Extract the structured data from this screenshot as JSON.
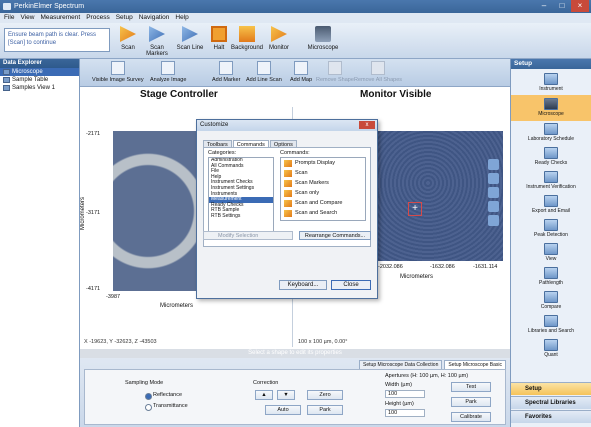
{
  "window": {
    "title": "PerkinElmer Spectrum"
  },
  "menu": [
    "File",
    "View",
    "Measurement",
    "Process",
    "Setup",
    "Navigation",
    "Help"
  ],
  "ribbon": {
    "message": "Ensure beam path is clear. Press [Scan] to continue",
    "buttons": [
      "Scan",
      "Scan Markers",
      "Scan Line",
      "Halt",
      "Background",
      "Monitor",
      "Microscope"
    ]
  },
  "sidebar": {
    "title": "Data Explorer",
    "items": [
      "Microscope",
      "Sample Table",
      "Samples View 1"
    ]
  },
  "toolbar": {
    "items": [
      {
        "label": "Visible Image Survey",
        "enabled": true
      },
      {
        "label": "Analyze Image",
        "enabled": true
      },
      {
        "label": "Add Marker",
        "enabled": true
      },
      {
        "label": "Add Line Scan",
        "enabled": true
      },
      {
        "label": "Add Map",
        "enabled": true
      },
      {
        "label": "Remove Shape",
        "enabled": false
      },
      {
        "label": "Remove All Shapes",
        "enabled": false
      }
    ]
  },
  "stage": {
    "title": "Stage Controller",
    "ylabel": "Micrometers",
    "xlabel": "Micrometers",
    "yticks": [
      "-2171",
      "-3171",
      "-4171"
    ],
    "xticks": [
      "-3987",
      "-2987"
    ],
    "status": "X -19623, Y -32623, Z -43503"
  },
  "monitor": {
    "title": "Monitor Visible",
    "xlabel": "Micrometers",
    "xticks": [
      "-2032.086",
      "-1632.086",
      "-1631.114"
    ],
    "status": "100 x 100 µm, 0.00°"
  },
  "dialog": {
    "title": "Customize",
    "close": "x",
    "tabs": [
      "Toolbars",
      "Commands",
      "Options"
    ],
    "categories_label": "Categories:",
    "commands_label": "Commands:",
    "categories": [
      "Administration",
      "All Commands",
      "File",
      "Help",
      "Instrument Checks",
      "Instrument Settings",
      "Instruments",
      "Measurement",
      "Ready Checks",
      "RTB Sample",
      "RTB Settings"
    ],
    "selected_category": 7,
    "commands": [
      "Prompts Display",
      "Scan",
      "Scan Markers",
      "Scan only",
      "Scan and Compare",
      "Scan and Search"
    ],
    "modify": "Modify Selection",
    "rearrange": "Rearrange Commands...",
    "keyboard": "Keyboard...",
    "close_btn": "Close"
  },
  "hint": "Select a shape to edit its properties",
  "bottom": {
    "tabs": [
      "Setup Microscope Data Collection",
      "Setup Microscope Basic"
    ],
    "sampling_label": "Sampling Mode",
    "reflectance": "Reflectance",
    "transmittance": "Transmittance",
    "correction_label": "Correction",
    "zero": "Zero",
    "auto": "Auto",
    "park": "Park",
    "apertures_label": "Apertures (H: 100 µm, H: 100 µm)",
    "width_label": "Width (µm)",
    "width_val": "100",
    "height_label": "Height (µm)",
    "height_val": "100",
    "test": "Test",
    "park2": "Park",
    "calibrate": "Calibrate"
  },
  "setup": {
    "title": "Setup",
    "items": [
      "Instrument",
      "Microscope",
      "Laboratory Schedule",
      "Ready Checks",
      "Instrument Verification",
      "Export and Email",
      "Peak Detection",
      "View",
      "Pathlength",
      "Compare",
      "Libraries and Search",
      "Quant"
    ],
    "active": 1,
    "nav": [
      "Setup",
      "Spectral Libraries",
      "Favorites"
    ]
  }
}
